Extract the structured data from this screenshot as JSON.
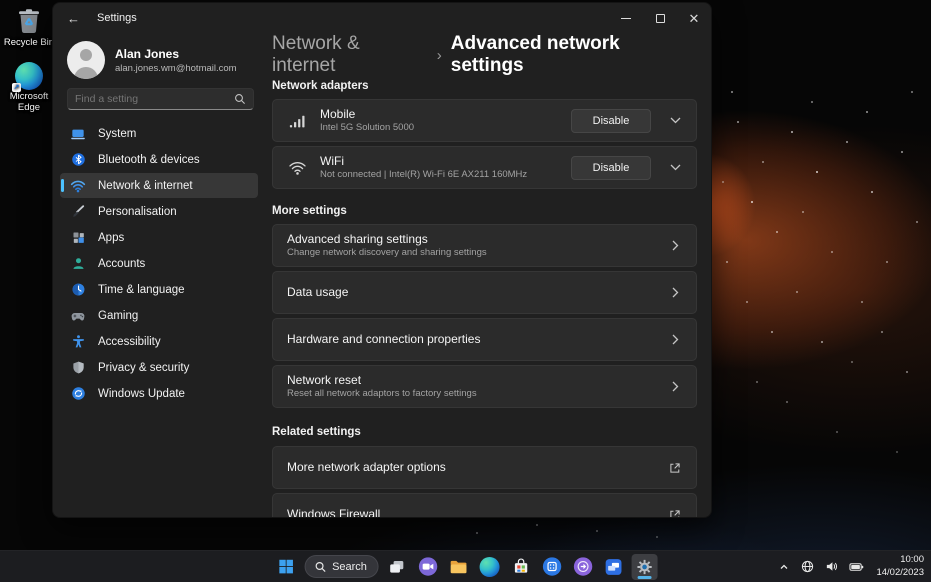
{
  "desktop": {
    "icons": [
      {
        "label": "Recycle Bin",
        "icon": "recycle-bin-icon"
      },
      {
        "label": "Microsoft Edge",
        "icon": "edge-icon"
      }
    ]
  },
  "window": {
    "title": "Settings",
    "profile": {
      "name": "Alan Jones",
      "email": "alan.jones.wm@hotmail.com"
    },
    "search": {
      "placeholder": "Find a setting"
    },
    "sidebar": [
      {
        "label": "System",
        "icon": "system-icon"
      },
      {
        "label": "Bluetooth & devices",
        "icon": "bluetooth-icon"
      },
      {
        "label": "Network & internet",
        "icon": "network-icon",
        "selected": true
      },
      {
        "label": "Personalisation",
        "icon": "personalisation-icon"
      },
      {
        "label": "Apps",
        "icon": "apps-icon"
      },
      {
        "label": "Accounts",
        "icon": "accounts-icon"
      },
      {
        "label": "Time & language",
        "icon": "time-language-icon"
      },
      {
        "label": "Gaming",
        "icon": "gaming-icon"
      },
      {
        "label": "Accessibility",
        "icon": "accessibility-icon"
      },
      {
        "label": "Privacy & security",
        "icon": "privacy-security-icon"
      },
      {
        "label": "Windows Update",
        "icon": "windows-update-icon"
      }
    ],
    "breadcrumb": {
      "parent": "Network & internet",
      "separator": "›",
      "current": "Advanced network settings"
    },
    "network_adapters": {
      "title": "Network adapters",
      "items": [
        {
          "name": "Mobile",
          "description": "Intel 5G Solution 5000",
          "button": "Disable",
          "icon": "cellular-signal-icon"
        },
        {
          "name": "WiFi",
          "description": "Not connected | Intel(R) Wi-Fi 6E AX211 160MHz",
          "button": "Disable",
          "icon": "wifi-icon"
        }
      ]
    },
    "more_settings": {
      "title": "More settings",
      "items": [
        {
          "title": "Advanced sharing settings",
          "subtitle": "Change network discovery and sharing settings"
        },
        {
          "title": "Data usage"
        },
        {
          "title": "Hardware and connection properties"
        },
        {
          "title": "Network reset",
          "subtitle": "Reset all network adaptors to factory settings"
        }
      ]
    },
    "related_settings": {
      "title": "Related settings",
      "items": [
        {
          "title": "More network adapter options"
        },
        {
          "title": "Windows Firewall"
        }
      ]
    }
  },
  "taskbar": {
    "search_label": "Search",
    "tray": {
      "time": "10:00",
      "date": "14/02/2023"
    }
  },
  "colors": {
    "accent": "#4cc2ff",
    "window_bg": "#202020",
    "card_bg": "#2b2b2b",
    "selected_bg": "#373737",
    "taskbar_bg": "#1d1e21"
  }
}
